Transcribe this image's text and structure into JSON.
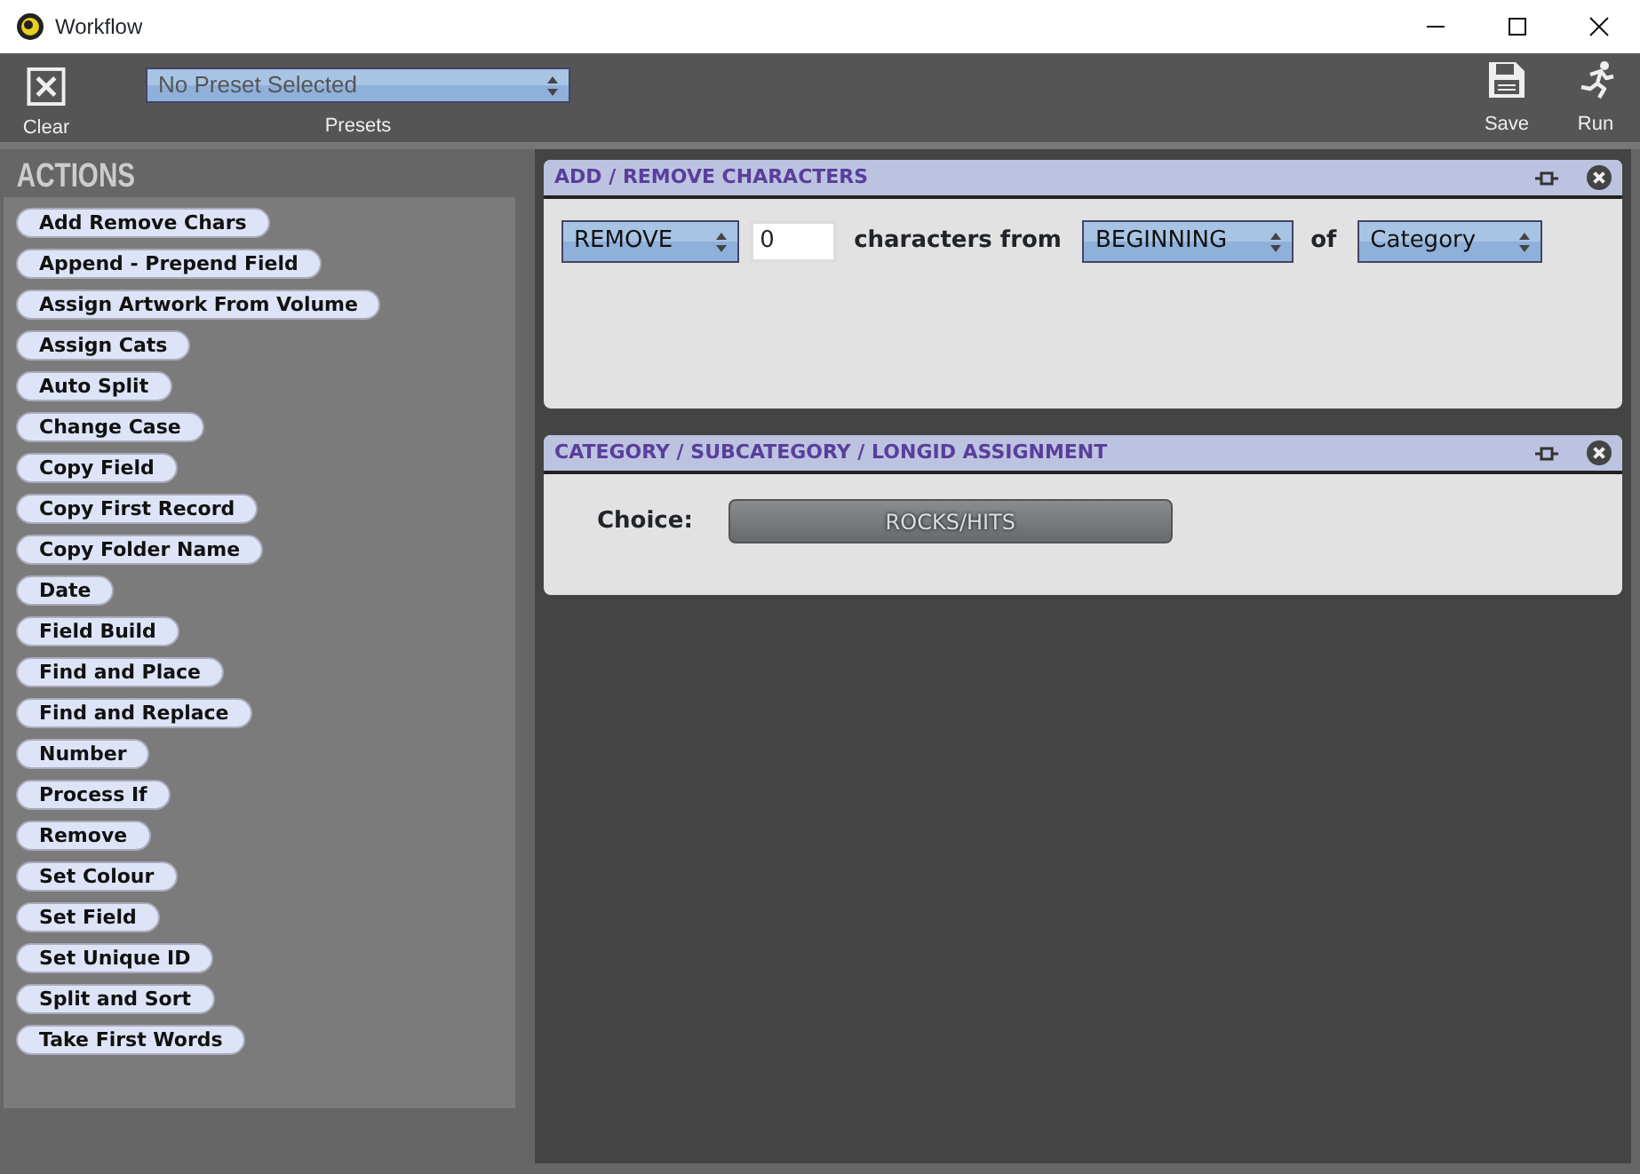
{
  "window": {
    "title": "Workflow"
  },
  "toolbar": {
    "clear_label": "Clear",
    "preset": {
      "value": "No Preset Selected",
      "label": "Presets"
    },
    "save_label": "Save",
    "run_label": "Run"
  },
  "actions": {
    "title": "ACTIONS",
    "items": [
      "Add Remove Chars",
      "Append - Prepend Field",
      "Assign Artwork From Volume",
      "Assign Cats",
      "Auto Split",
      "Change Case",
      "Copy Field",
      "Copy First Record",
      "Copy Folder Name",
      "Date",
      "Field Build",
      "Find and Place",
      "Find and Replace",
      "Number",
      "Process If",
      "Remove",
      "Set Colour",
      "Set Field",
      "Set Unique ID",
      "Split and Sort",
      "Take First Words"
    ]
  },
  "panels": [
    {
      "title": "ADD / REMOVE CHARACTERS",
      "kind": "row",
      "parts": [
        {
          "kind": "select",
          "value": "REMOVE"
        },
        {
          "kind": "input",
          "value": "0"
        },
        {
          "kind": "text",
          "value": "characters from"
        },
        {
          "kind": "select",
          "value": "BEGINNING"
        },
        {
          "kind": "text",
          "value": "of"
        },
        {
          "kind": "select",
          "value": "Category"
        }
      ]
    },
    {
      "title": "CATEGORY / SUBCATEGORY / LONGID ASSIGNMENT",
      "kind": "choice",
      "label": "Choice:",
      "value": "ROCKS/HITS"
    }
  ]
}
